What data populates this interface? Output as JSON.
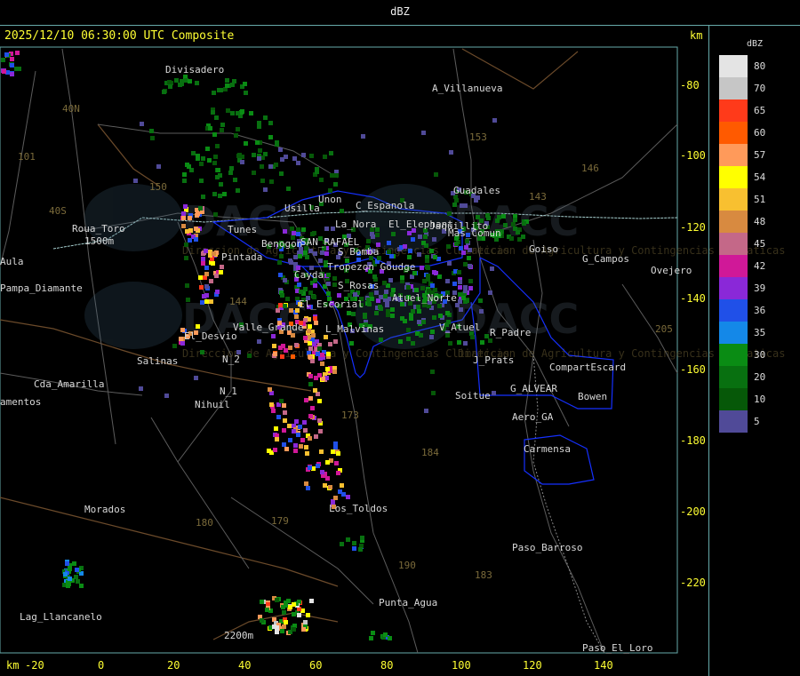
{
  "header": {
    "title": "dBZ"
  },
  "timestamp": "2025/12/10 06:30:00 UTC Composite",
  "unit_top": "km",
  "unit_bottom": "km",
  "x_axis_ticks": [
    "-20",
    "0",
    "20",
    "40",
    "60",
    "80",
    "100",
    "120",
    "140"
  ],
  "y_axis_ticks": [
    "-80",
    "-100",
    "-120",
    "-140",
    "-160",
    "-180",
    "-200",
    "-220"
  ],
  "legend": {
    "title": "dBZ",
    "entries": [
      {
        "label": "80",
        "color": "#e4e4e4"
      },
      {
        "label": "70",
        "color": "#c6c6c6"
      },
      {
        "label": "65",
        "color": "#ff3a1a"
      },
      {
        "label": "60",
        "color": "#ff5a00"
      },
      {
        "label": "57",
        "color": "#ff9a5a"
      },
      {
        "label": "54",
        "color": "#ffff00"
      },
      {
        "label": "51",
        "color": "#f8c030"
      },
      {
        "label": "48",
        "color": "#d88a40"
      },
      {
        "label": "45",
        "color": "#c46888"
      },
      {
        "label": "42",
        "color": "#d01898"
      },
      {
        "label": "39",
        "color": "#8a28d8"
      },
      {
        "label": "36",
        "color": "#2050e8"
      },
      {
        "label": "35",
        "color": "#1488e8"
      },
      {
        "label": "30",
        "color": "#0a8c14"
      },
      {
        "label": "20",
        "color": "#087010"
      },
      {
        "label": "10",
        "color": "#065808"
      },
      {
        "label": "5",
        "color": "#504a98"
      }
    ]
  },
  "places": [
    "Divisadero",
    "A_Villanueva",
    "Unon",
    "Usilla",
    "C_Espanola",
    "La_Nora",
    "El_Elephant",
    "Jaquillito",
    "Guadales",
    "Goiso",
    "G_Campos",
    "Ovejero",
    "Tunes",
    "Benogon",
    "SAN_RAFAEL",
    "S_Bomba",
    "Pintada",
    "Tropezon Goudge",
    "Cayda",
    "S_Rosas",
    "Atuel_Norte",
    "El_Escorial",
    "Valle_Grande",
    "L_Malvinas",
    "V_Atuel",
    "R_Padre",
    "El_Desvio",
    "Salinas",
    "N_2",
    "N_1",
    "Nihuil",
    "J_Prats",
    "CompartEscard",
    "Soitue",
    "G_ALVEAR",
    "Bowen",
    "Aero_GA",
    "Carmensa",
    "Roua_Toro",
    "1500m",
    "Aula",
    "Pampa_Diamante",
    "Cda_Amarilla",
    "amentos",
    "Morados",
    "Los_Toldos",
    "Paso_Barroso",
    "Punta_Agua",
    "Lag_Llancanelo",
    "2200m",
    "Paso_El_Loro",
    "Mas_Comun"
  ],
  "routes": [
    "101",
    "40N",
    "153",
    "146",
    "150",
    "143",
    "144",
    "40S",
    "173",
    "184",
    "180",
    "179",
    "190",
    "183",
    "205"
  ],
  "watermark": "Direccion de Agricultura y Contingencias Climaticas"
}
